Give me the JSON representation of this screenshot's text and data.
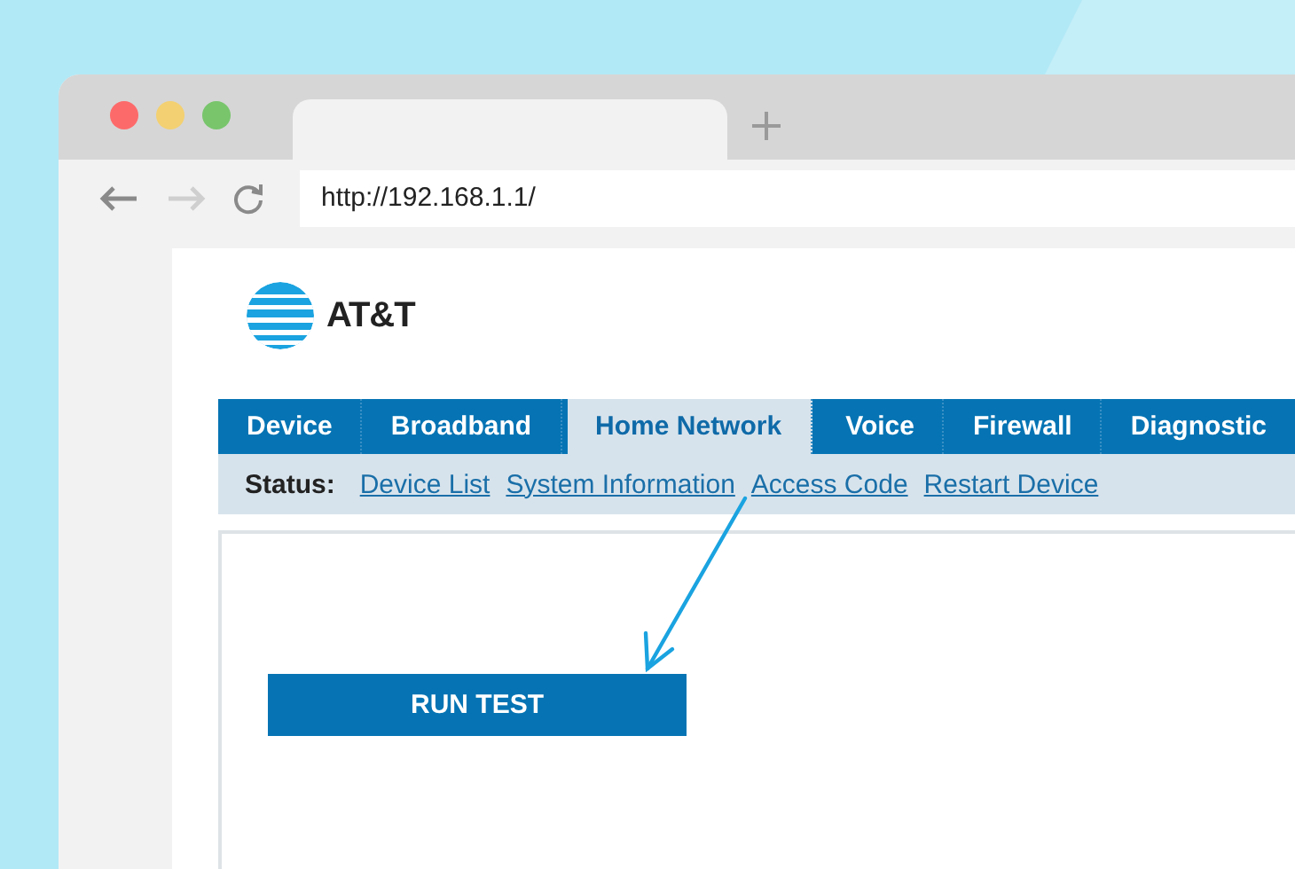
{
  "browser": {
    "url": "http://192.168.1.1/"
  },
  "page": {
    "logo_text": "AT&T",
    "tabs": [
      {
        "label": "Device",
        "selected": false
      },
      {
        "label": "Broadband",
        "selected": false
      },
      {
        "label": "Home Network",
        "selected": true
      },
      {
        "label": "Voice",
        "selected": false
      },
      {
        "label": "Firewall",
        "selected": false
      },
      {
        "label": "Diagnostic",
        "selected": false
      }
    ],
    "status_label": "Status:",
    "links": [
      "Device List",
      "System Information",
      "Access Code",
      "Restart Device"
    ],
    "button": "RUN TEST"
  }
}
